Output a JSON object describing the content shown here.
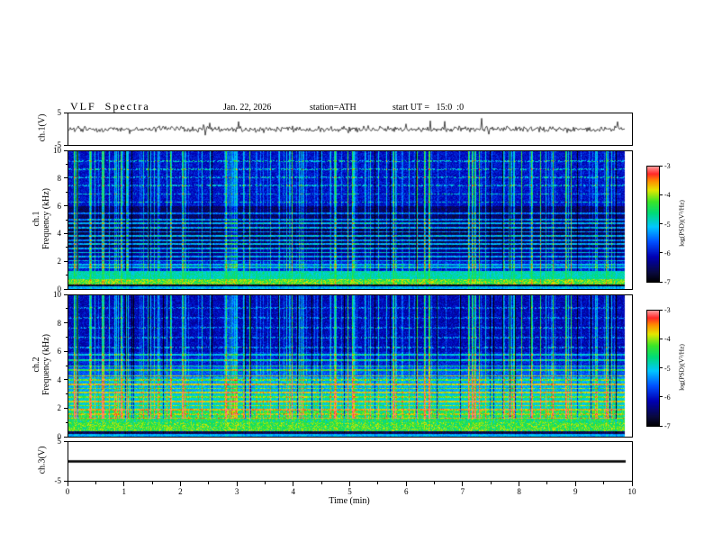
{
  "title": {
    "main": "VLF  Spectra",
    "date": "Jan. 22, 2026",
    "station": "station=ATH",
    "start_ut": "start UT =   15:0  :0"
  },
  "x_axis": {
    "label": "Time  (min)",
    "min": 0,
    "max": 10,
    "ticks": [
      "0",
      "1",
      "2",
      "3",
      "4",
      "5",
      "6",
      "7",
      "8",
      "9",
      "10"
    ]
  },
  "colorbar": {
    "label": "log(PSD)(V²/Hz)",
    "ticks": [
      "-3",
      "-4",
      "-5",
      "-6",
      "-7"
    ],
    "zlim": [
      -7,
      -3
    ],
    "stops": [
      {
        "t": 0.0,
        "c": [
          0,
          0,
          0
        ]
      },
      {
        "t": 0.08,
        "c": [
          10,
          10,
          60
        ]
      },
      {
        "t": 0.22,
        "c": [
          0,
          0,
          180
        ]
      },
      {
        "t": 0.35,
        "c": [
          0,
          80,
          255
        ]
      },
      {
        "t": 0.48,
        "c": [
          0,
          200,
          255
        ]
      },
      {
        "t": 0.6,
        "c": [
          0,
          220,
          120
        ]
      },
      {
        "t": 0.7,
        "c": [
          60,
          230,
          40
        ]
      },
      {
        "t": 0.8,
        "c": [
          230,
          230,
          0
        ]
      },
      {
        "t": 0.88,
        "c": [
          255,
          140,
          0
        ]
      },
      {
        "t": 0.94,
        "c": [
          255,
          40,
          40
        ]
      },
      {
        "t": 1.0,
        "c": [
          255,
          150,
          150
        ]
      }
    ]
  },
  "chart_data": [
    {
      "type": "line",
      "name": "ch1_waveform",
      "ylabel": "ch.1(V)",
      "ylim": [
        -5,
        5
      ],
      "yticks": [
        5,
        -5
      ],
      "xlim": [
        0,
        10
      ],
      "description": "Continuous broadband noise trace, mean 0 V, typical amplitude about ±1 V with frequent impulsive spikes reaching about ±3 V across the full 10 minutes."
    },
    {
      "type": "heatmap",
      "name": "ch1_spectrogram",
      "ylabel_lines": [
        "ch.1",
        "Frequency (kHz)"
      ],
      "yticks": [
        0,
        2,
        4,
        6,
        8,
        10
      ],
      "ylim": [
        0,
        10
      ],
      "xlim": [
        0,
        10
      ],
      "zlim": [
        -7,
        -3
      ],
      "zlabel": "log(PSD)(V²/Hz)",
      "bands": [
        {
          "f": [
            6,
            10
          ],
          "level": -6.0
        },
        {
          "f": [
            4.5,
            6
          ],
          "level": -6.5
        },
        {
          "f": [
            3,
            4.5
          ],
          "level": -6.6
        },
        {
          "f": [
            2,
            3
          ],
          "level": -6.3
        },
        {
          "f": [
            1.3,
            2
          ],
          "level": -5.9
        },
        {
          "f": [
            0.7,
            1.3
          ],
          "level": -4.8
        },
        {
          "f": [
            0.35,
            0.7
          ],
          "level": -4.2
        },
        {
          "f": [
            0.18,
            0.35
          ],
          "level": -6.9
        },
        {
          "f": [
            0,
            0.18
          ],
          "level": -5.2
        }
      ],
      "harmonic_lines": [
        {
          "f": 1.55,
          "level": -5.0
        },
        {
          "f": 1.75,
          "level": -5.1
        },
        {
          "f": 2.05,
          "level": -5.2
        },
        {
          "f": 2.35,
          "level": -5.3
        },
        {
          "f": 2.65,
          "level": -5.1
        },
        {
          "f": 2.95,
          "level": -5.3
        },
        {
          "f": 3.25,
          "level": -5.2
        },
        {
          "f": 3.55,
          "level": -5.4
        },
        {
          "f": 3.85,
          "level": -5.2
        },
        {
          "f": 4.15,
          "level": -5.4
        },
        {
          "f": 4.45,
          "level": -5.3
        },
        {
          "f": 4.75,
          "level": -5.2
        },
        {
          "f": 5.05,
          "level": -5.4
        },
        {
          "f": 5.5,
          "level": -5.5
        },
        {
          "f": 6.3,
          "level": -5.0,
          "speckle": true
        },
        {
          "f": 6.9,
          "level": -5.0,
          "speckle": true
        },
        {
          "f": 7.5,
          "level": -5.0,
          "speckle": true
        },
        {
          "f": 8.1,
          "level": -5.0,
          "speckle": true
        },
        {
          "f": 8.7,
          "level": -5.0,
          "speckle": true
        },
        {
          "f": 9.3,
          "level": -5.0,
          "speckle": true
        }
      ],
      "impulses": {
        "strong_prob": 0.06,
        "strong_boost": 1.7,
        "medium_prob": 0.1,
        "medium_boost": 1.0,
        "weak_prob": 0.1,
        "weak_boost": 0.5,
        "dark_prob": 0.02,
        "dark_boost": -1.0,
        "low_freq_scale": 0.25
      },
      "noise": 0.5,
      "description": "Mostly deep-blue background (~-6.5) between 2 and 10 kHz crossed by dense vertical sferic impulses (green/yellow, full height), thin cyan power-line harmonic lines 2-5.5 kHz, speckled green lines 6-9.5 kHz, bright yellow/red band near 0.35-0.7 kHz, dark band near 0.2-0.35 kHz."
    },
    {
      "type": "heatmap",
      "name": "ch2_spectrogram",
      "ylabel_lines": [
        "ch.2",
        "Frequency (kHz)"
      ],
      "yticks": [
        0,
        2,
        4,
        6,
        8,
        10
      ],
      "ylim": [
        0,
        10
      ],
      "xlim": [
        0,
        10
      ],
      "zlim": [
        -7,
        -3
      ],
      "zlabel": "log(PSD)(V²/Hz)",
      "bands": [
        {
          "f": [
            6,
            10
          ],
          "level": -6.1
        },
        {
          "f": [
            5,
            6
          ],
          "level": -5.9
        },
        {
          "f": [
            4.2,
            5
          ],
          "level": -5.6
        },
        {
          "f": [
            3,
            4.2
          ],
          "level": -5.2
        },
        {
          "f": [
            2,
            3
          ],
          "level": -4.9
        },
        {
          "f": [
            1,
            2
          ],
          "level": -4.5
        },
        {
          "f": [
            0.4,
            1
          ],
          "level": -4.3
        },
        {
          "f": [
            0.18,
            0.4
          ],
          "level": -6.6
        },
        {
          "f": [
            0,
            0.18
          ],
          "level": -5.2
        }
      ],
      "harmonic_lines": [
        {
          "f": 1.3,
          "level": -3.8
        },
        {
          "f": 1.6,
          "level": -4.0
        },
        {
          "f": 1.9,
          "level": -3.7
        },
        {
          "f": 2.2,
          "level": -4.0
        },
        {
          "f": 2.5,
          "level": -3.8
        },
        {
          "f": 2.8,
          "level": -4.1
        },
        {
          "f": 3.1,
          "level": -3.9
        },
        {
          "f": 3.4,
          "level": -4.1
        },
        {
          "f": 3.7,
          "level": -3.8
        },
        {
          "f": 4.0,
          "level": -4.2
        },
        {
          "f": 4.3,
          "level": -4.0
        },
        {
          "f": 4.7,
          "level": -4.4
        },
        {
          "f": 5.0,
          "level": -4.6
        },
        {
          "f": 5.4,
          "level": -4.8
        },
        {
          "f": 5.8,
          "level": -5.0
        },
        {
          "f": 6.3,
          "level": -5.2,
          "speckle": true
        },
        {
          "f": 7.0,
          "level": -5.3,
          "speckle": true
        },
        {
          "f": 7.7,
          "level": -5.3,
          "speckle": true
        },
        {
          "f": 8.4,
          "level": -5.4,
          "speckle": true
        },
        {
          "f": 9.1,
          "level": -5.4,
          "speckle": true
        }
      ],
      "impulses": {
        "strong_prob": 0.06,
        "strong_boost": 1.5,
        "medium_prob": 0.1,
        "medium_boost": 0.9,
        "weak_prob": 0.1,
        "weak_boost": 0.45,
        "dark_prob": 0.02,
        "dark_boost": -1.1,
        "low_freq_scale": 0.15
      },
      "extra_dark": 0.03,
      "noise": 0.5,
      "description": "Greener overall than ch.1: green/cyan diffuse power below 5 kHz with many yellow/orange/red horizontal harmonic lines 1-4.5 kHz, blue background above 6 kHz with vertical green impulses and occasional black dropout columns, dark band near 0.2-0.4 kHz."
    },
    {
      "type": "line",
      "name": "ch3_waveform",
      "ylabel": "ch.3(V)",
      "ylim": [
        -5,
        5
      ],
      "yticks": [
        5,
        -5
      ],
      "xlim": [
        0,
        10
      ],
      "constant_value": 0,
      "description": "Flat thick black trace at 0 V for the entire record (channel flat-lined)."
    }
  ]
}
